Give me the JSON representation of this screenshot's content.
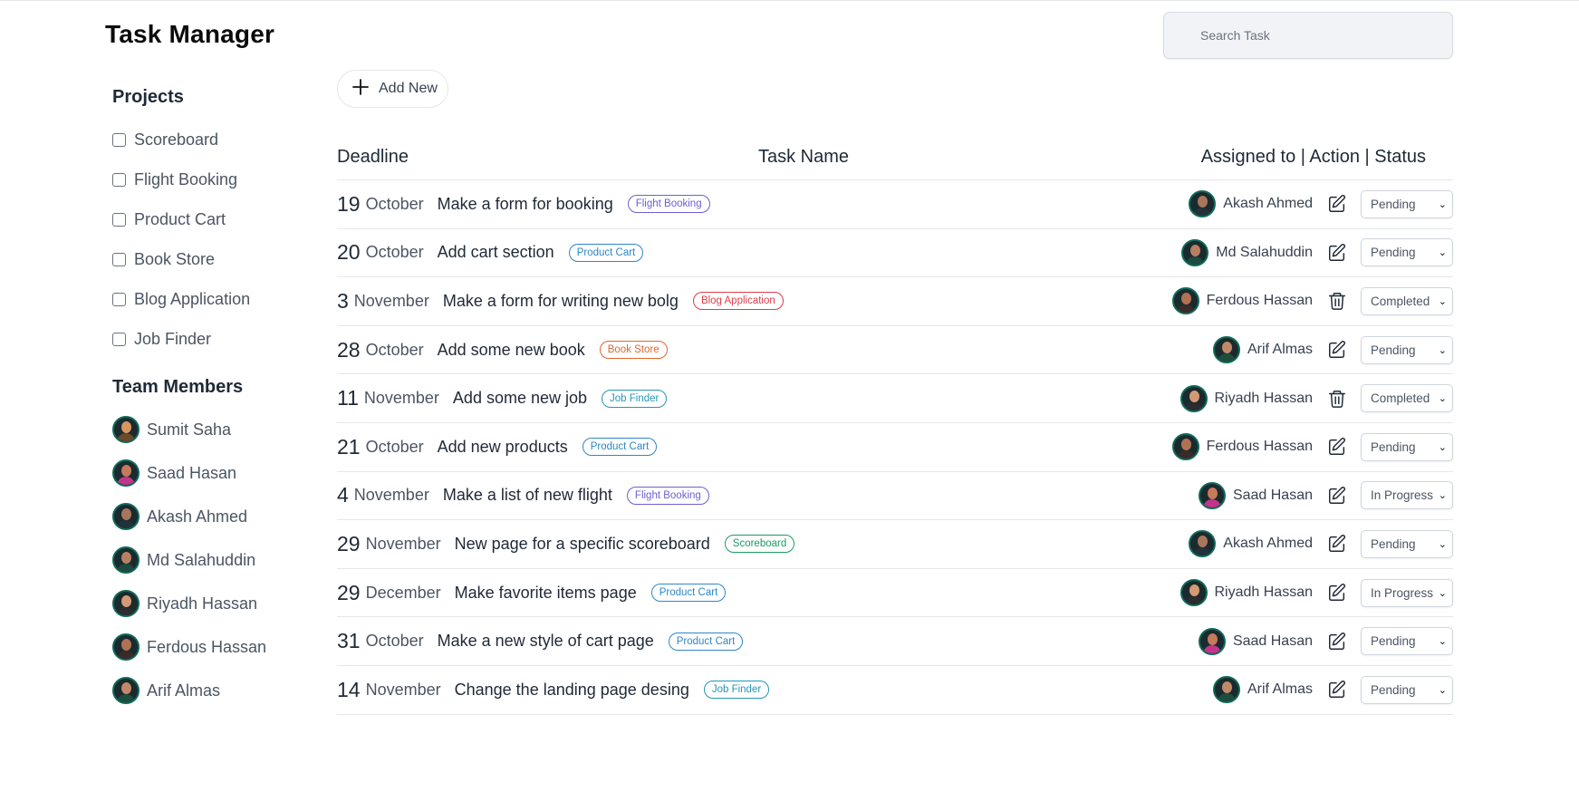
{
  "app": {
    "title": "Task Manager"
  },
  "search": {
    "placeholder": "Search Task"
  },
  "toolbar": {
    "add_label": "Add New"
  },
  "sidebar": {
    "projects_title": "Projects",
    "projects": [
      {
        "label": "Scoreboard"
      },
      {
        "label": "Flight Booking"
      },
      {
        "label": "Product Cart"
      },
      {
        "label": "Book Store"
      },
      {
        "label": "Blog Application"
      },
      {
        "label": "Job Finder"
      }
    ],
    "team_title": "Team Members",
    "members": [
      {
        "name": "Sumit Saha"
      },
      {
        "name": "Saad Hasan"
      },
      {
        "name": "Akash Ahmed"
      },
      {
        "name": "Md Salahuddin"
      },
      {
        "name": "Riyadh Hassan"
      },
      {
        "name": "Ferdous Hassan"
      },
      {
        "name": "Arif Almas"
      }
    ]
  },
  "table": {
    "headers": {
      "deadline": "Deadline",
      "task": "Task Name",
      "right": "Assigned to | Action | Status"
    },
    "rows": [
      {
        "day": "19",
        "month": "October",
        "task": "Make a form for booking",
        "project": "Flight Booking",
        "assignee": "Akash Ahmed",
        "action": "edit-icon",
        "status": "Pending"
      },
      {
        "day": "20",
        "month": "October",
        "task": "Add cart section",
        "project": "Product Cart",
        "assignee": "Md Salahuddin",
        "action": "edit-icon",
        "status": "Pending"
      },
      {
        "day": "3",
        "month": "November",
        "task": "Make a form for writing new bolg",
        "project": "Blog Application",
        "assignee": "Ferdous Hassan",
        "action": "trash-icon",
        "status": "Completed"
      },
      {
        "day": "28",
        "month": "October",
        "task": "Add some new book",
        "project": "Book Store",
        "assignee": "Arif Almas",
        "action": "edit-icon",
        "status": "Pending"
      },
      {
        "day": "11",
        "month": "November",
        "task": "Add some new job",
        "project": "Job Finder",
        "assignee": "Riyadh Hassan",
        "action": "trash-icon",
        "status": "Completed"
      },
      {
        "day": "21",
        "month": "October",
        "task": "Add new products",
        "project": "Product Cart",
        "assignee": "Ferdous Hassan",
        "action": "edit-icon",
        "status": "Pending"
      },
      {
        "day": "4",
        "month": "November",
        "task": "Make a list of new flight",
        "project": "Flight Booking",
        "assignee": "Saad Hasan",
        "action": "edit-icon",
        "status": "In Progress"
      },
      {
        "day": "29",
        "month": "November",
        "task": "New page for a specific scoreboard",
        "project": "Scoreboard",
        "assignee": "Akash Ahmed",
        "action": "edit-icon",
        "status": "Pending"
      },
      {
        "day": "29",
        "month": "December",
        "task": "Make favorite items page",
        "project": "Product Cart",
        "assignee": "Riyadh Hassan",
        "action": "edit-icon",
        "status": "In Progress"
      },
      {
        "day": "31",
        "month": "October",
        "task": "Make a new style of cart page",
        "project": "Product Cart",
        "assignee": "Saad Hasan",
        "action": "edit-icon",
        "status": "Pending"
      },
      {
        "day": "14",
        "month": "November",
        "task": "Change the landing page desing",
        "project": "Job Finder",
        "assignee": "Arif Almas",
        "action": "edit-icon",
        "status": "Pending"
      }
    ]
  },
  "colors": {
    "Flight Booking": "#6d5fd3",
    "Product Cart": "#2f87c6",
    "Blog Application": "#dc3d4b",
    "Book Store": "#e0662f",
    "Job Finder": "#2596b5",
    "Scoreboard": "#1f9a62",
    "avatar_ring": "#0f6b58"
  }
}
